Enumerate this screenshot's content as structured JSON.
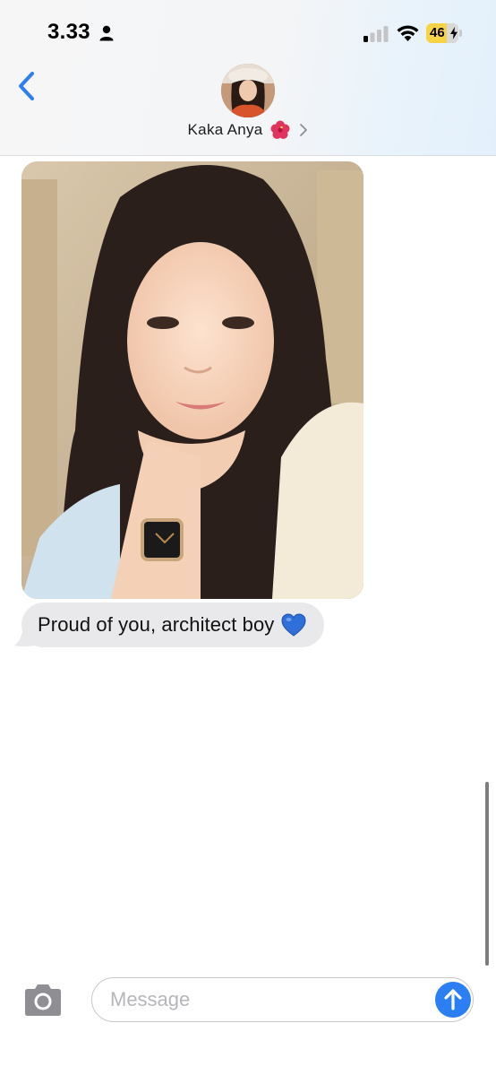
{
  "status_bar": {
    "time": "3.33",
    "battery_level": "46",
    "icons": [
      "person-icon",
      "cellular-signal-icon",
      "wifi-icon",
      "battery-charging-icon"
    ]
  },
  "header": {
    "contact_name": "Kaka Anya",
    "contact_emoji": "hibiscus-icon",
    "icons": [
      "back-chevron-icon",
      "chevron-right-icon"
    ]
  },
  "conversation": {
    "messages": [
      {
        "type": "photo",
        "sender": "contact",
        "description_icon": "photo-attachment"
      },
      {
        "type": "text",
        "sender": "contact",
        "text": "Proud of you, architect boy",
        "emoji": "blue-heart-icon"
      }
    ]
  },
  "input_bar": {
    "placeholder": "Message",
    "value": "",
    "icons": [
      "camera-icon",
      "send-arrow-icon"
    ]
  },
  "colors": {
    "accent": "#2b7ff2",
    "incoming_bubble": "#e9e9eb",
    "battery_fill": "#f7d445",
    "heart": "#2f6fd9"
  }
}
